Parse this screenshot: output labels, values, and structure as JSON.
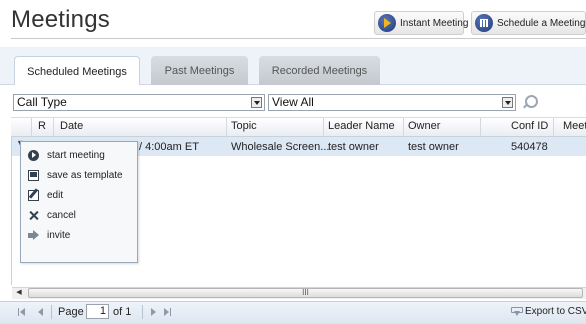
{
  "header": {
    "title": "Meetings",
    "instant_meeting_label": "Instant Meeting",
    "schedule_meeting_label": "Schedule a Meeting"
  },
  "tabs": [
    {
      "label": "Scheduled Meetings",
      "active": true
    },
    {
      "label": "Past Meetings",
      "active": false
    },
    {
      "label": "Recorded Meetings",
      "active": false
    }
  ],
  "filters": {
    "call_type": "Call Type",
    "view": "View All"
  },
  "grid": {
    "columns": [
      "R",
      "Date",
      "Topic",
      "Leader Name",
      "Owner",
      "Conf ID",
      "Meeti"
    ],
    "rows": [
      {
        "date_partial": "/ 4:00am ET",
        "topic": "Wholesale Screen...",
        "leader": "test owner",
        "owner": "test owner",
        "conf_id": "540478"
      }
    ]
  },
  "context_menu": {
    "items": [
      {
        "label": "start meeting",
        "icon": "play-icon"
      },
      {
        "label": "save as template",
        "icon": "template-icon"
      },
      {
        "label": "edit",
        "icon": "edit-icon"
      },
      {
        "label": "cancel",
        "icon": "cancel-icon"
      },
      {
        "label": "invite",
        "icon": "invite-arrow-icon"
      }
    ]
  },
  "scrollbar": {
    "grip": "III"
  },
  "pager": {
    "page_label": "Page",
    "page_value": "1",
    "of_text": "of 1",
    "export_label": "Export to CSV"
  },
  "colors": {
    "accent_blue": "#1f3a7a",
    "row_selected": "#dde8f5",
    "tab_strip": "#eef3f9"
  }
}
